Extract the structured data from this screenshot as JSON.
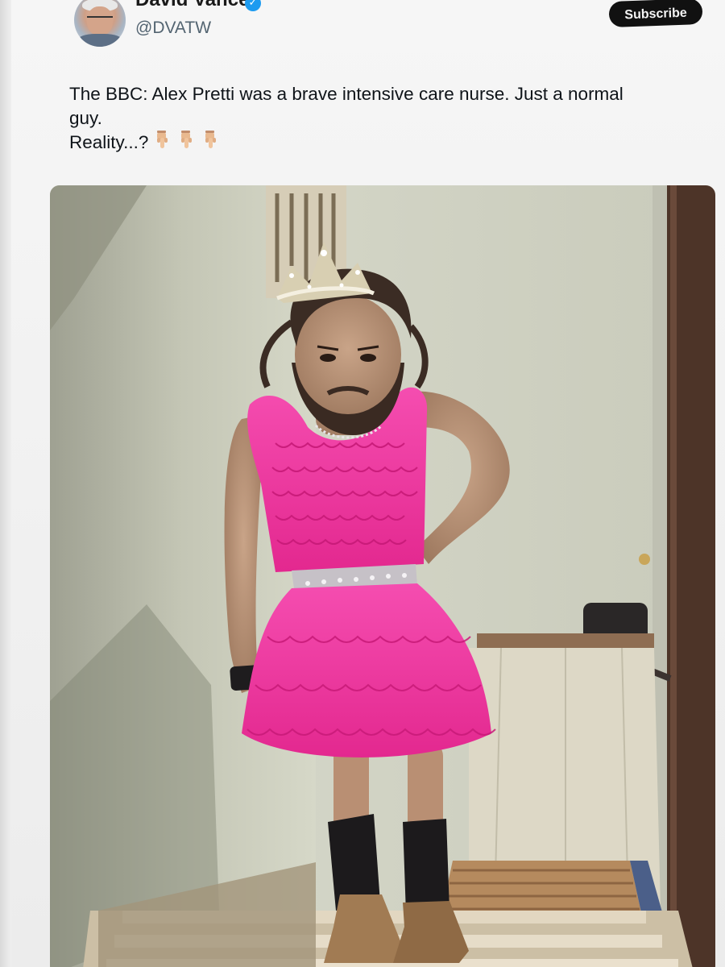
{
  "tweet": {
    "author": {
      "display_name": "David Vance",
      "handle": "@DVATW",
      "avatar_icon": "profile-photo",
      "verified_icon": "verified-badge-icon",
      "verified_color": "#1d9bf0"
    },
    "subscribe_label": "Subscribe",
    "text_lines": [
      "The BBC: Alex Pretti was a brave intensive care nurse. Just a normal",
      "guy.",
      "Reality...?"
    ],
    "emoji_icons": [
      "pointing-down-icon",
      "pointing-down-icon",
      "pointing-down-icon"
    ],
    "media": {
      "type": "photo",
      "content": "man in tiara and pink ruffled dress standing on stairs"
    }
  },
  "colors": {
    "text": "#0f1419",
    "secondary_text": "#536471",
    "button_bg": "#111111",
    "dress_pink": "#f23aa6"
  }
}
